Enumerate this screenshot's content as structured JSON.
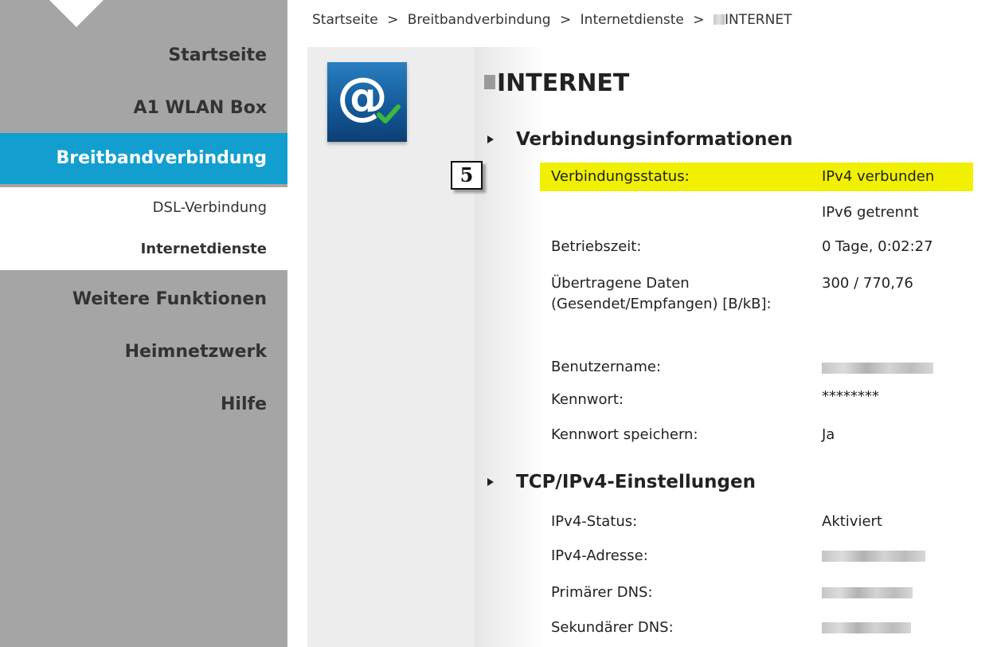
{
  "sidebar": {
    "items": [
      {
        "label": "Startseite"
      },
      {
        "label": "A1 WLAN Box"
      },
      {
        "label": "Breitbandverbindung"
      },
      {
        "label": "DSL-Verbindung"
      },
      {
        "label": "Internetdienste"
      },
      {
        "label": "Weitere Funktionen"
      },
      {
        "label": "Heimnetzwerk"
      },
      {
        "label": "Hilfe"
      }
    ]
  },
  "breadcrumb": {
    "items": [
      "Startseite",
      "Breitbandverbindung",
      "Internetdienste",
      "INTERNET"
    ],
    "separator": ">"
  },
  "page": {
    "title": "INTERNET",
    "step_badge": "5",
    "icon_glyph": "@"
  },
  "sections": {
    "connection": {
      "title": "Verbindungsinformationen",
      "rows": [
        {
          "label": "Verbindungsstatus:",
          "value": "IPv4 verbunden"
        },
        {
          "label": "",
          "value": "IPv6 getrennt"
        },
        {
          "label": "Betriebszeit:",
          "value": "0 Tage, 0:02:27"
        },
        {
          "label": "Übertragene Daten (Gesendet/Empfangen) [B/kB]:",
          "value": "300 / 770,76"
        },
        {
          "label": "Benutzername:",
          "value": ""
        },
        {
          "label": "Kennwort:",
          "value": "********"
        },
        {
          "label": "Kennwort speichern:",
          "value": "Ja"
        }
      ]
    },
    "tcp": {
      "title": "TCP/IPv4-Einstellungen",
      "rows": [
        {
          "label": "IPv4-Status:",
          "value": "Aktiviert"
        },
        {
          "label": "IPv4-Adresse:",
          "value": ""
        },
        {
          "label": "Primärer DNS:",
          "value": ""
        },
        {
          "label": "Sekundärer DNS:",
          "value": ""
        }
      ]
    }
  },
  "colors": {
    "sidebar_bg": "#a5a5a5",
    "active_nav": "#129fd0",
    "highlight": "#f0f000",
    "icon_blue": "#145a9a",
    "check_green": "#3cb83c"
  },
  "icons": {
    "app_icon": "internet-at-icon",
    "check": "check-icon",
    "section_toggle": "triangle-right-icon"
  }
}
